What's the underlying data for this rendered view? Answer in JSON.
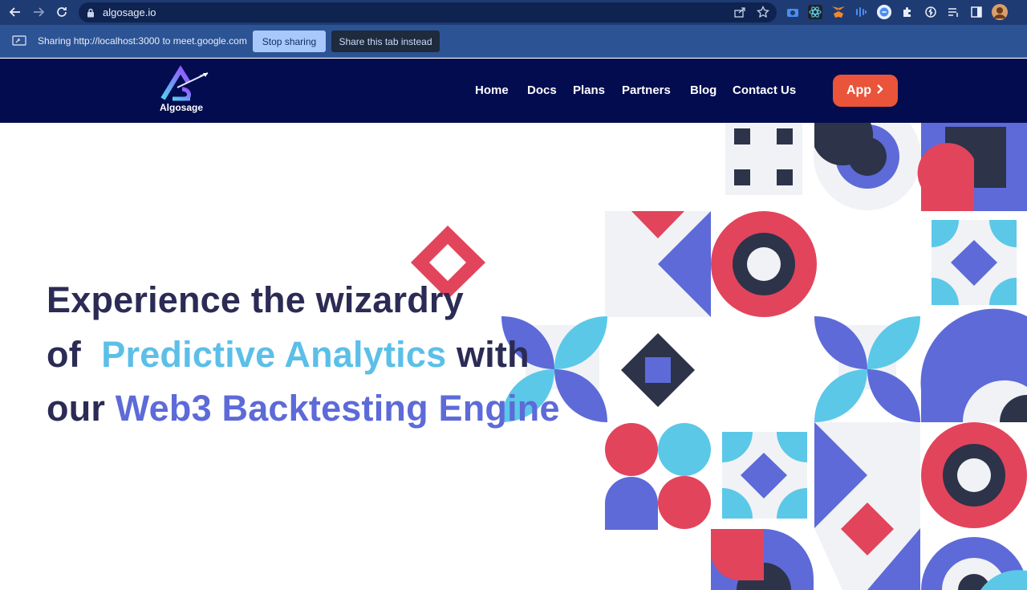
{
  "browser": {
    "url": "algosage.io",
    "share_bar": {
      "text": "Sharing http://localhost:3000 to meet.google.com",
      "stop_label": "Stop sharing",
      "share_tab_label": "Share this tab instead"
    }
  },
  "site": {
    "logo_text": "Algosage",
    "nav": [
      "Home",
      "Docs",
      "Plans",
      "Partners",
      "Blog",
      "Contact Us"
    ],
    "app_button": "App"
  },
  "hero": {
    "line1": "Experience the wizardry",
    "line2_prefix": "of ",
    "line2_highlight": "Predictive Analytics",
    "line2_suffix": " with",
    "line3_prefix": "our ",
    "line3_highlight": "Web3 Backtesting Engine"
  },
  "colors": {
    "header_bg": "#030c4f",
    "app_button": "#e9543a",
    "text_dark": "#2b2b55",
    "accent_light_blue": "#5bbfe8",
    "accent_purple": "#5d6ad8",
    "pattern_red": "#e2445c",
    "pattern_navy": "#2d3349"
  }
}
